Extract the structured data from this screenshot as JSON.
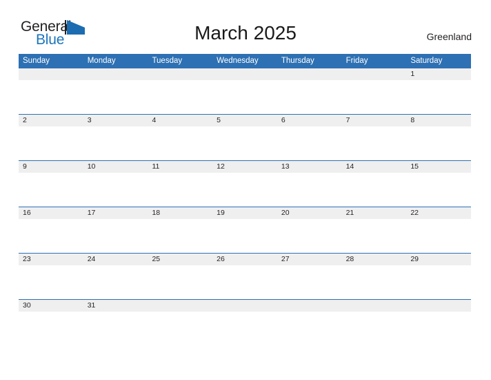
{
  "brand": {
    "name_top": "General",
    "name_bottom": "Blue",
    "flag_icon": "flag-triangle-icon",
    "accent_color": "#1b75bc"
  },
  "header": {
    "title": "March 2025",
    "locale": "Greenland"
  },
  "colors": {
    "header_blue": "#2d70b3",
    "row_band_gray": "#efefef",
    "separator_blue": "#2d70b3",
    "text_dark": "#231f20",
    "page_background": "#ffffff"
  },
  "calendar": {
    "month": "March",
    "year": "2025",
    "weekdays": [
      "Sunday",
      "Monday",
      "Tuesday",
      "Wednesday",
      "Thursday",
      "Friday",
      "Saturday"
    ],
    "weeks": [
      {
        "days": [
          "",
          "",
          "",
          "",
          "",
          "",
          "1"
        ]
      },
      {
        "days": [
          "2",
          "3",
          "4",
          "5",
          "6",
          "7",
          "8"
        ]
      },
      {
        "days": [
          "9",
          "10",
          "11",
          "12",
          "13",
          "14",
          "15"
        ]
      },
      {
        "days": [
          "16",
          "17",
          "18",
          "19",
          "20",
          "21",
          "22"
        ]
      },
      {
        "days": [
          "23",
          "24",
          "25",
          "26",
          "27",
          "28",
          "29"
        ]
      },
      {
        "days": [
          "30",
          "31",
          "",
          "",
          "",
          "",
          ""
        ]
      }
    ]
  }
}
